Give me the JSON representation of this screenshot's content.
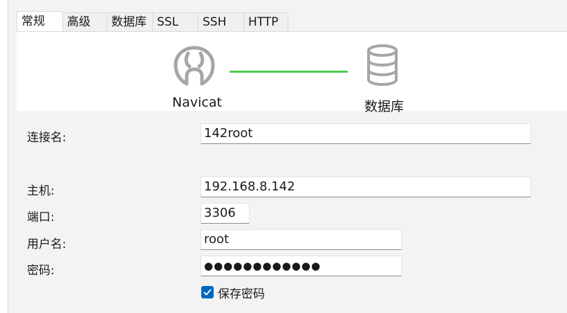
{
  "tabs": [
    {
      "label": "常规",
      "active": true
    },
    {
      "label": "高级",
      "active": false
    },
    {
      "label": "数据库",
      "active": false
    },
    {
      "label": "SSL",
      "active": false
    },
    {
      "label": "SSH",
      "active": false
    },
    {
      "label": "HTTP",
      "active": false
    }
  ],
  "banner": {
    "left_label": "Navicat",
    "right_label": "数据库",
    "left_icon": "navicat-logo-icon",
    "right_icon": "database-icon",
    "connector_color": "#4ccb4c"
  },
  "form": {
    "connection_name": {
      "label": "连接名:",
      "value": "142root"
    },
    "host": {
      "label": "主机:",
      "value": "192.168.8.142"
    },
    "port": {
      "label": "端口:",
      "value": "3306"
    },
    "username": {
      "label": "用户名:",
      "value": "root"
    },
    "password": {
      "label": "密码:",
      "value": "●●●●●●●●●●●●"
    },
    "save_password": {
      "label": "保存密码",
      "checked": true
    }
  },
  "colors": {
    "accent": "#0067c0",
    "connector": "#4ccb4c"
  }
}
